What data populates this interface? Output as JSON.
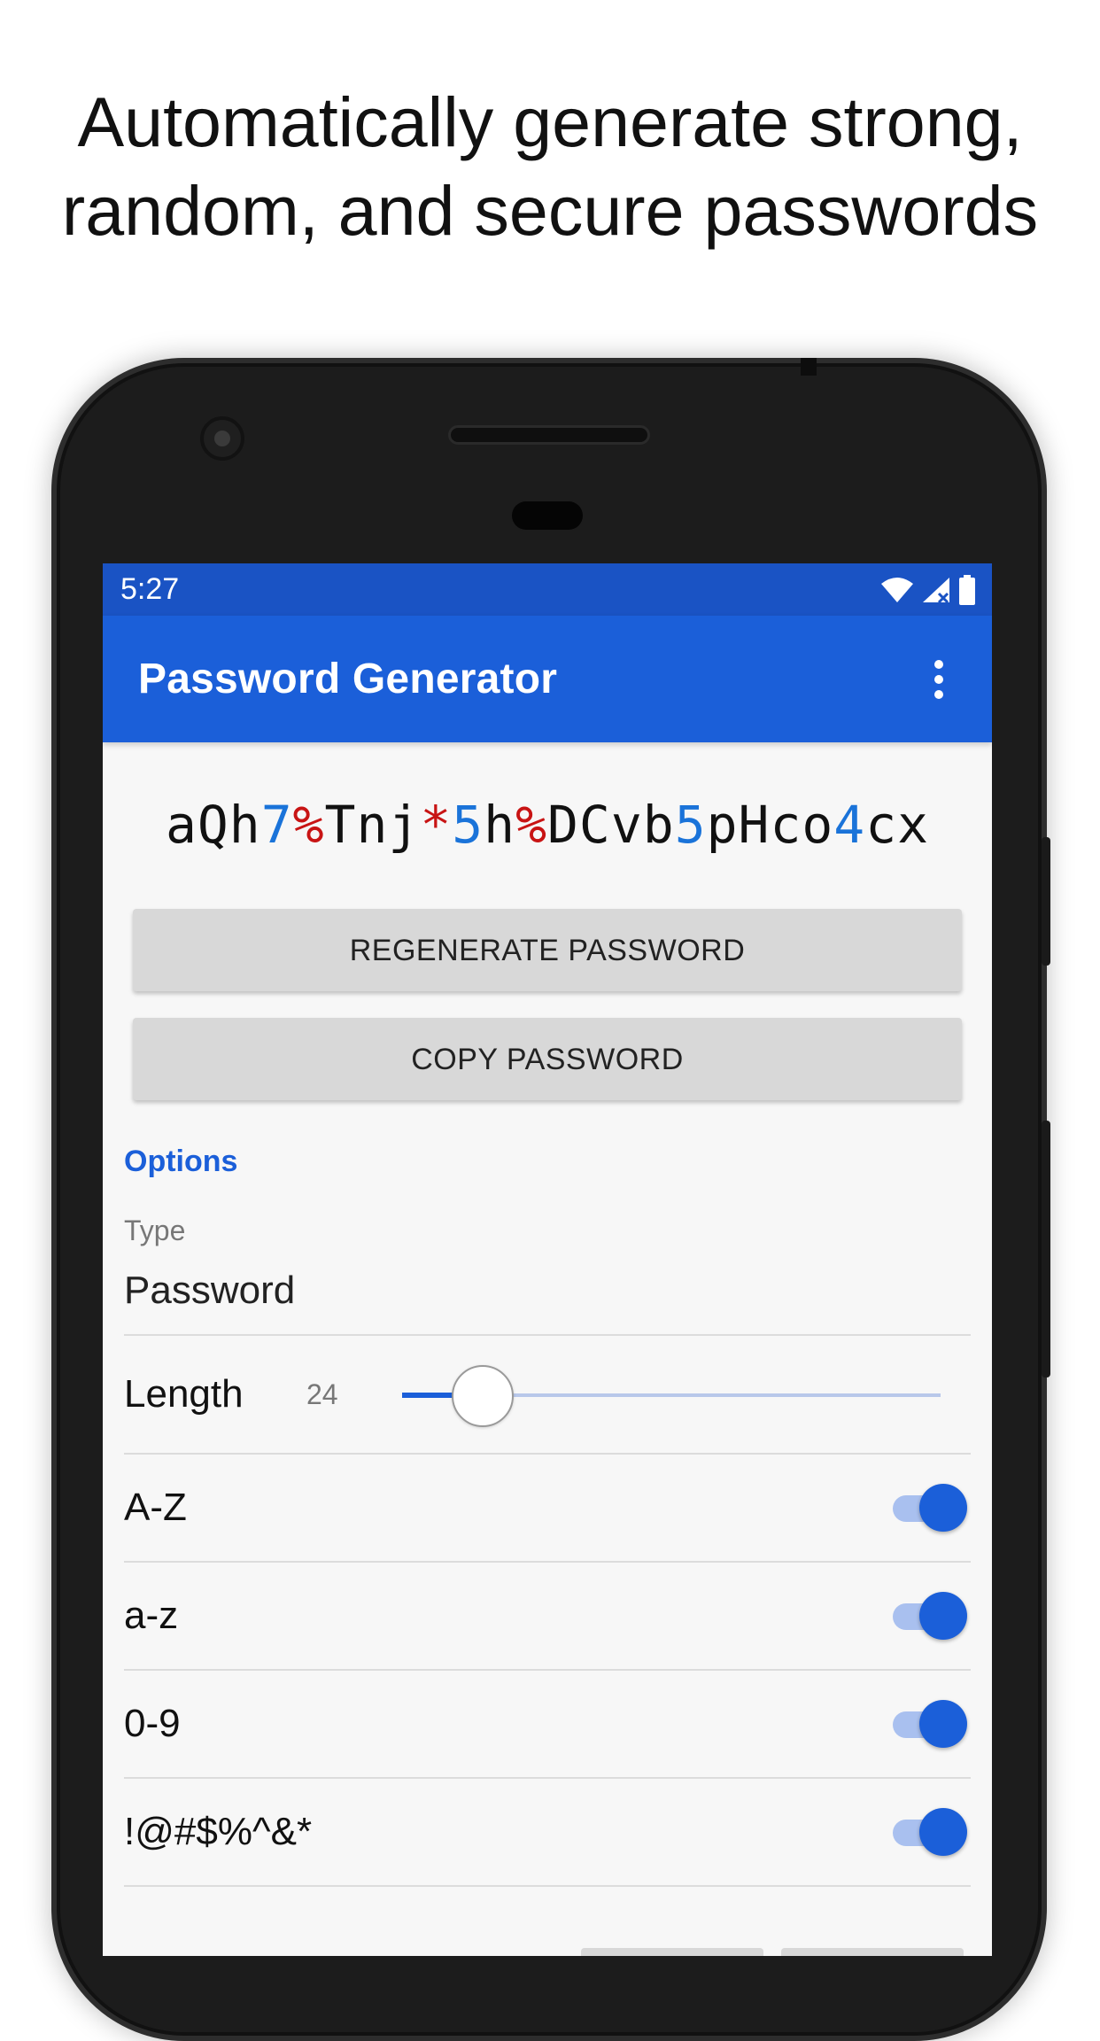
{
  "headline": {
    "line1": "Automatically generate strong,",
    "line2": "random, and secure passwords"
  },
  "status_bar": {
    "time": "5:27",
    "icons": [
      "wifi-icon",
      "signal-icon",
      "battery-icon"
    ]
  },
  "app_bar": {
    "title": "Password Generator",
    "menu_icon": "more-vert-icon"
  },
  "password": {
    "value": "aQh7%Tnj*5h%DCvb5pHco4cx"
  },
  "buttons": {
    "regenerate": "REGENERATE PASSWORD",
    "copy": "COPY PASSWORD"
  },
  "options": {
    "header": "Options",
    "type_label": "Type",
    "type_value": "Password",
    "length_label": "Length",
    "length_value": "24",
    "length_slider_fraction": 0.15,
    "toggles": [
      {
        "label": "A-Z",
        "on": true
      },
      {
        "label": "a-z",
        "on": true
      },
      {
        "label": "0-9",
        "on": true
      },
      {
        "label": "!@#$%^&*",
        "on": true
      }
    ]
  },
  "colors": {
    "primary": "#1b5fd9",
    "status_bar": "#1a53c4",
    "digit": "#1a73d9",
    "symbol": "#c81414"
  }
}
